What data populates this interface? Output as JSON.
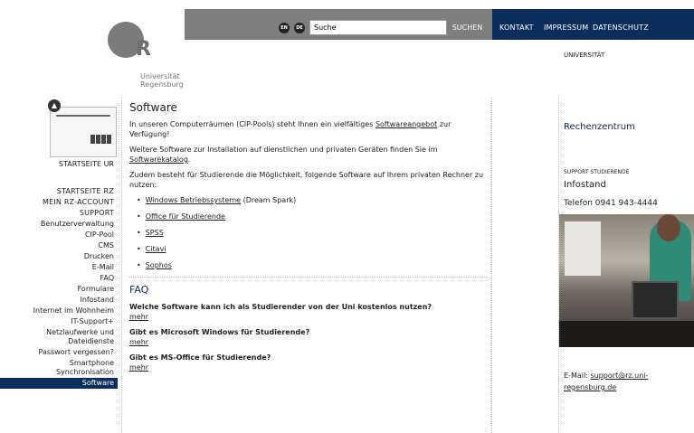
{
  "header": {
    "logo_text": "R",
    "logo_subtitle": "Universität Regensburg",
    "lang_en": "EN",
    "lang_de": "DE",
    "search_value": "Suche",
    "search_button": "SUCHEN",
    "topnav": [
      "KONTAKT",
      "IMPRESSUM",
      "DATENSCHUTZ"
    ],
    "university_label": "UNIVERSITÄT"
  },
  "sidebar": {
    "home_label": "STARTSEITE UR",
    "items": [
      "STARTSEITE RZ",
      "MEIN RZ-ACCOUNT",
      "SUPPORT",
      "Benutzerverwaltung",
      "CIP-Pool",
      "CMS",
      "Drucken",
      "E-Mail",
      "FAQ",
      "Formulare",
      "Infostand",
      "Internet im Wohnheim",
      "IT-Support+",
      "Netzlaufwerke und Dateidienste",
      "Passwort vergessen?",
      "Smartphone Synchronisation",
      "Software"
    ],
    "active_item": "Software"
  },
  "main": {
    "title": "Software",
    "p1_text": "In unseren Computerräumen (CIP-Pools) steht Ihnen ein vielfältiges ",
    "p1_link": "Softwareangebot",
    "p1_tail": " zur Verfügung!",
    "p2_text": "Weitere Software zur Installation auf dienstlichen und privaten Geräten finden Sie im ",
    "p2_link": "Softwarekatalog",
    "p2_tail": ".",
    "p3_text": "Zudem besteht für Studierende die Möglichkeit, folgende Software auf Ihrem privaten Rechner zu nutzen:",
    "list": [
      {
        "link": "Windows Betriebssysteme",
        "tail": " (Dream Spark)"
      },
      {
        "link": "Office für Studierende",
        "tail": ""
      },
      {
        "link": "SPSS",
        "tail": ""
      },
      {
        "link": "Citavi",
        "tail": ""
      },
      {
        "link": "Sophos",
        "tail": ""
      }
    ],
    "faq_title": "FAQ",
    "faq": [
      {
        "q": "Welche Software kann ich als Studierender von der Uni kostenlos nutzen?",
        "more": "mehr"
      },
      {
        "q": "Gibt es Microsoft Windows für Studierende?",
        "more": "mehr"
      },
      {
        "q": "Gibt es MS-Office für Studierende?",
        "more": "mehr"
      }
    ]
  },
  "right": {
    "title": "Rechenzentrum",
    "support_label": "SUPPORT STUDIERENDE",
    "infostand": "Infostand",
    "phone": "Telefon 0941 943-4444",
    "email_label": "E-Mail: ",
    "email_link": "support@rz.uni-regensburg.de"
  },
  "colors": {
    "navy": "#0b2d5b",
    "gray_bar": "#7e7e7e"
  }
}
